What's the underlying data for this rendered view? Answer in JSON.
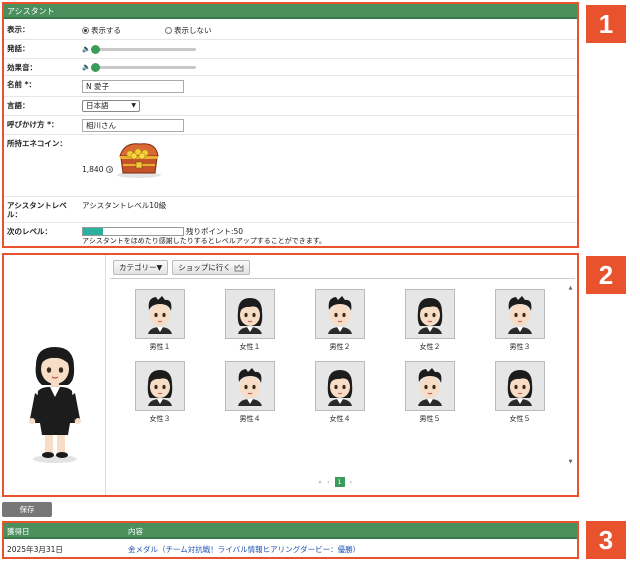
{
  "colors": {
    "header_green": "#4a8f5c",
    "callout": "#e8522c",
    "accent_green": "#3b9b5a",
    "progress_teal": "#2bb0a0",
    "link_blue": "#1a4fb0"
  },
  "callouts": [
    "1",
    "2",
    "3"
  ],
  "assistant": {
    "header": "アシスタント",
    "display": {
      "label": "表示：",
      "options": [
        "表示する",
        "表示しない"
      ],
      "selected": 0
    },
    "voice": {
      "label": "発話：",
      "icon": "speaker-icon",
      "level": 0
    },
    "sfx": {
      "label": "効果音：",
      "icon": "speaker-icon",
      "level": 0
    },
    "name": {
      "label": "名前 *：",
      "value": "N 愛子"
    },
    "language": {
      "label": "言語：",
      "value": "日本語"
    },
    "callname": {
      "label": "呼びかけ方 *：",
      "value": "相川さん"
    },
    "coins": {
      "label": "所持エネコイン：",
      "value": "1,840",
      "coin_icon": "coin-icon",
      "image_icon": "treasure-chest-icon"
    },
    "level": {
      "label": "アシスタントレベル：",
      "value": "アシスタントレベル10級"
    },
    "next_level": {
      "label": "次のレベル：",
      "progress": 0.2,
      "remaining": "残りポイント:50",
      "note": "アシスタントをほめたり感謝したりするとレベルアップすることができます。"
    }
  },
  "avatars": {
    "category_button": "カテゴリー▼",
    "shop_button": "ショップに行く",
    "shop_icon": "crown-icon",
    "items": [
      {
        "label": "男性１",
        "gender": "m"
      },
      {
        "label": "女性１",
        "gender": "f"
      },
      {
        "label": "男性２",
        "gender": "m"
      },
      {
        "label": "女性２",
        "gender": "f"
      },
      {
        "label": "男性３",
        "gender": "m"
      },
      {
        "label": "女性３",
        "gender": "f"
      },
      {
        "label": "男性４",
        "gender": "m"
      },
      {
        "label": "女性４",
        "gender": "f"
      },
      {
        "label": "男性５",
        "gender": "m"
      },
      {
        "label": "女性５",
        "gender": "f"
      }
    ],
    "pager": {
      "first": "«",
      "prev": "‹",
      "current": "1",
      "next": "›"
    }
  },
  "save_button": "保存",
  "history": {
    "columns": [
      "獲得日",
      "内容"
    ],
    "rows": [
      {
        "date": "2025年3月31日",
        "content": "金メダル（チーム対抗戦！ライバル情報ヒアリングダービー：優勝）"
      }
    ]
  }
}
